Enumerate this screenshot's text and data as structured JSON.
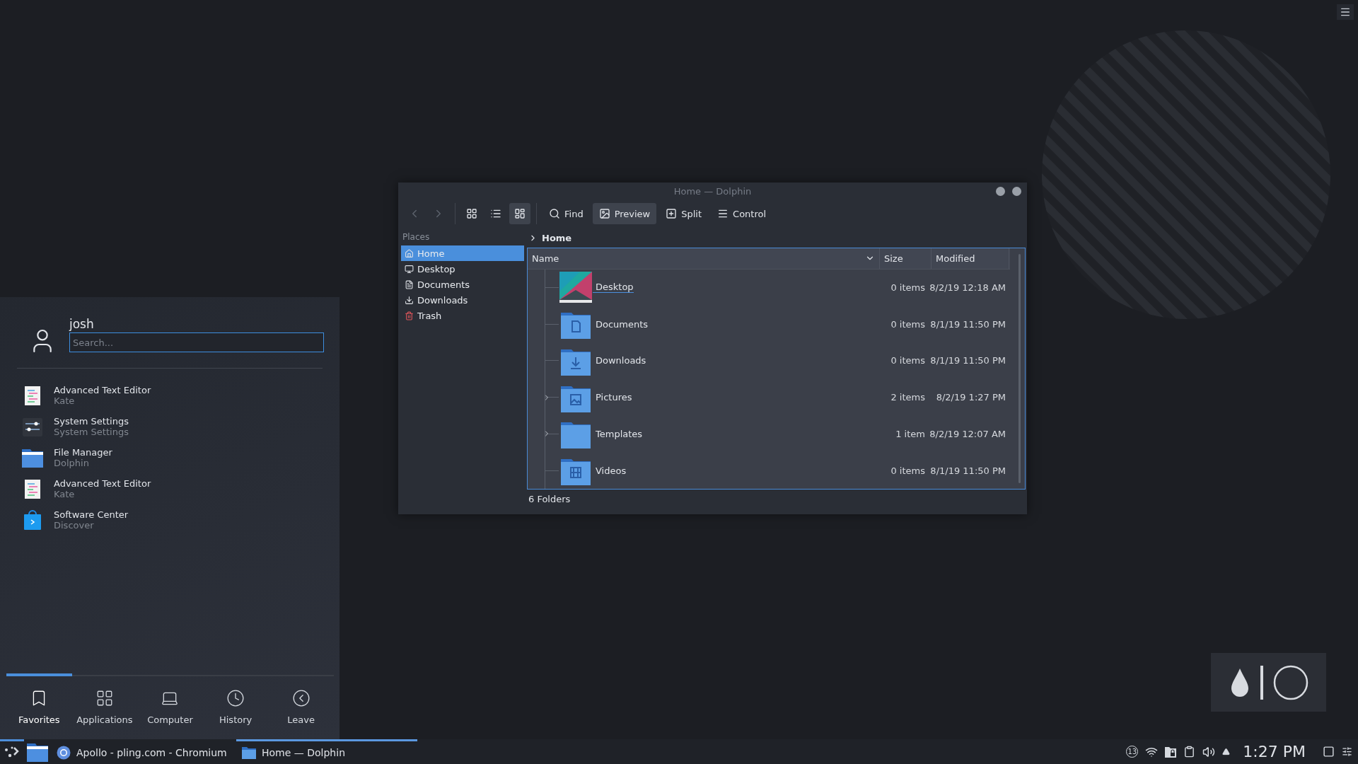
{
  "dolphin": {
    "title": "Home — Dolphin",
    "nav": [
      {
        "kind": "back",
        "disabled": true
      },
      {
        "kind": "forward",
        "disabled": true
      }
    ],
    "view_modes": [
      {
        "kind": "icons",
        "selected": false
      },
      {
        "kind": "compact",
        "selected": false
      },
      {
        "kind": "details",
        "selected": true
      }
    ],
    "actions": [
      {
        "kind": "find",
        "label": "Find",
        "on": false
      },
      {
        "kind": "preview",
        "label": "Preview",
        "on": true
      },
      {
        "kind": "split",
        "label": "Split",
        "on": false
      },
      {
        "kind": "control",
        "label": "Control",
        "on": false
      }
    ],
    "places": {
      "title": "Places",
      "items": [
        {
          "kind": "home",
          "label": "Home",
          "selected": true
        },
        {
          "kind": "desktop",
          "label": "Desktop",
          "selected": false
        },
        {
          "kind": "documents",
          "label": "Documents",
          "selected": false
        },
        {
          "kind": "downloads",
          "label": "Downloads",
          "selected": false
        },
        {
          "kind": "trash",
          "label": "Trash",
          "selected": false
        }
      ]
    },
    "breadcrumb": "Home",
    "table": {
      "columns": [
        "Name",
        "Size",
        "Modified"
      ],
      "rows": [
        {
          "kind": "desktop",
          "name": "Desktop",
          "size": "0 items",
          "modified": "8/2/19 12:18 AM",
          "expandable": false,
          "hovered": true
        },
        {
          "kind": "documents",
          "name": "Documents",
          "size": "0 items",
          "modified": "8/1/19 11:50 PM",
          "expandable": false,
          "hovered": false
        },
        {
          "kind": "downloads",
          "name": "Downloads",
          "size": "0 items",
          "modified": "8/1/19 11:50 PM",
          "expandable": false,
          "hovered": false
        },
        {
          "kind": "pictures",
          "name": "Pictures",
          "size": "2 items",
          "modified": "8/2/19 1:27 PM",
          "expandable": true,
          "hovered": false
        },
        {
          "kind": "templates",
          "name": "Templates",
          "size": "1 item",
          "modified": "8/2/19 12:07 AM",
          "expandable": true,
          "hovered": false
        },
        {
          "kind": "videos",
          "name": "Videos",
          "size": "0 items",
          "modified": "8/1/19 11:50 PM",
          "expandable": false,
          "hovered": false
        }
      ]
    },
    "status_bar": "6 Folders"
  },
  "launcher": {
    "user": "josh",
    "search": {
      "placeholder": "Search..."
    },
    "favorites": [
      {
        "kind": "editor",
        "title": "Advanced Text Editor",
        "subtitle": "Kate"
      },
      {
        "kind": "settings",
        "title": "System Settings",
        "subtitle": "System Settings"
      },
      {
        "kind": "files",
        "title": "File Manager",
        "subtitle": "Dolphin"
      },
      {
        "kind": "editor",
        "title": "Advanced Text Editor",
        "subtitle": "Kate"
      },
      {
        "kind": "store",
        "title": "Software Center",
        "subtitle": "Discover"
      }
    ],
    "tabs": [
      {
        "kind": "favorites",
        "label": "Favorites",
        "selected": true
      },
      {
        "kind": "applications",
        "label": "Applications",
        "selected": false
      },
      {
        "kind": "computer",
        "label": "Computer",
        "selected": false
      },
      {
        "kind": "history",
        "label": "History",
        "selected": false
      },
      {
        "kind": "leave",
        "label": "Leave",
        "selected": false
      }
    ]
  },
  "taskbar": {
    "start": {
      "active": true
    },
    "tasks": [
      {
        "kind": "browser",
        "label": "Apollo - pling.com - Chromium",
        "selected": false
      },
      {
        "kind": "files",
        "label": "Home — Dolphin",
        "selected": true
      }
    ],
    "notifications": "13",
    "clock": "1:27 PM"
  }
}
